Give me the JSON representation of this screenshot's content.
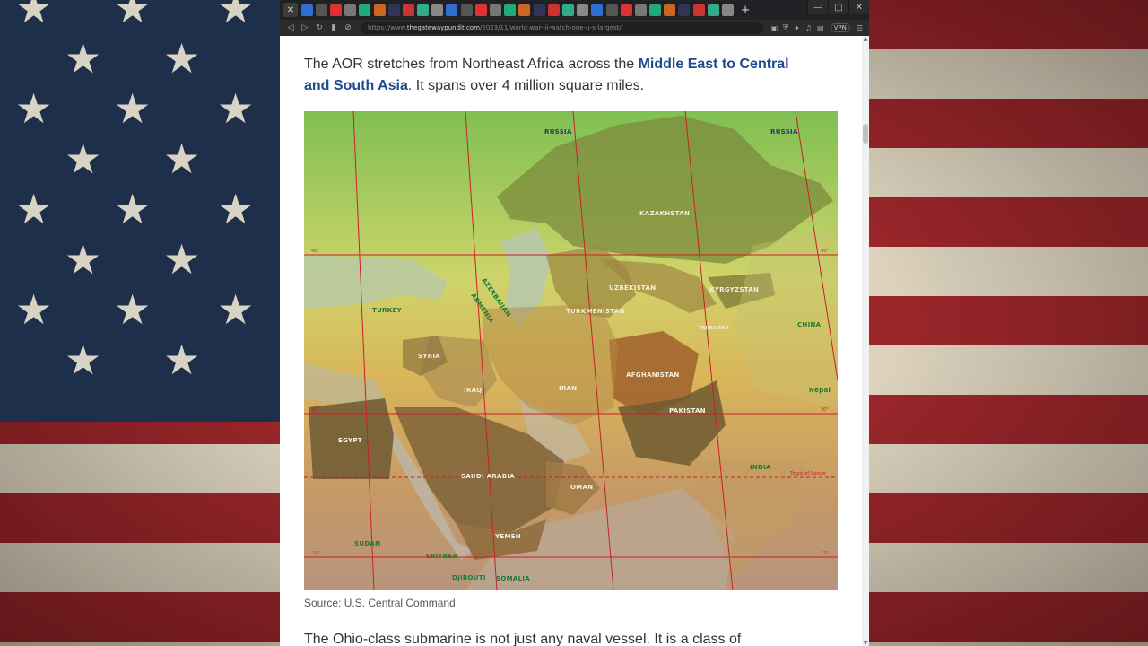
{
  "browser": {
    "url_prefix": "https://www.",
    "url_domain": "thegatewaypundit.com",
    "url_path": "/2023/11/world-war-iii-watch-one-u-s-largest/",
    "vpn_label": "VPN",
    "tab_count": 30
  },
  "article": {
    "lead_text_1": "The AOR stretches from Northeast Africa across the ",
    "lead_link": "Middle East to Central and South Asia",
    "lead_text_2": ". It spans over 4 million square miles.",
    "image_caption": "Source: U.S. Central Command",
    "next_paragraph": "The Ohio-class submarine is not just any naval vessel. It is a class of"
  },
  "map": {
    "labels": {
      "russia_w": "RUSSIA",
      "russia_e": "RUSSIA",
      "kazakhstan": "KAZAKHSTAN",
      "uzbekistan": "UZBEKISTAN",
      "kyrgyzstan": "KYRGYZSTAN",
      "turkmenistan": "TURKMENISTAN",
      "tajikistan": "TAJIKISTAN",
      "azerbaijan": "AZERBAIJAN",
      "armenia": "ARMENIA",
      "turkey": "TURKEY",
      "syria": "SYRIA",
      "iraq": "IRAQ",
      "iran": "IRAN",
      "afghanistan": "AFGHANISTAN",
      "pakistan": "PAKISTAN",
      "china": "CHINA",
      "nepal": "Nepal",
      "india": "INDIA",
      "egypt": "EGYPT",
      "saudi_arabia": "SAUDI ARABIA",
      "oman": "OMAN",
      "yemen": "YEMEN",
      "sudan": "SUDAN",
      "eritrea": "ERITREA",
      "djibouti": "DJIBOUTI",
      "somalia": "SOMALIA",
      "tropic": "Tropic of Cancer",
      "lat_45_w": "45°",
      "lat_45_e": "45°",
      "lat_30_w": "30°",
      "lat_30_e": "30°",
      "lat_15_w": "15°",
      "lat_15_e": "15°"
    }
  },
  "colors": {
    "link": "#1e4b8f",
    "grid_line": "#c8202a",
    "flag_red": "#a8262b",
    "flag_white": "#d8cdb6",
    "flag_blue": "#1d2f4a"
  }
}
